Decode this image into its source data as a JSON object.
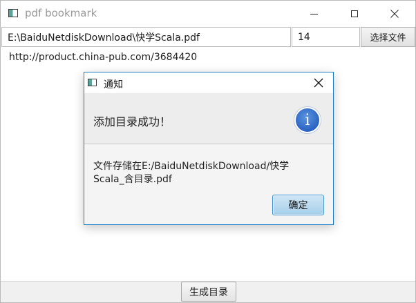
{
  "window": {
    "title": "pdf bookmark",
    "icon": "app-window-icon",
    "controls": {
      "minimize": "minimize-icon",
      "maximize": "maximize-icon",
      "close": "close-icon"
    }
  },
  "toolbar": {
    "file_path_value": "E:\\BaiduNetdiskDownload\\快学Scala.pdf",
    "page_offset_value": "14",
    "choose_file_label": "选择文件"
  },
  "main": {
    "url_text": "http://product.china-pub.com/3684420"
  },
  "footer": {
    "generate_label": "生成目录"
  },
  "dialog": {
    "title": "通知",
    "header_text": "添加目录成功！",
    "header_icon": "info-icon",
    "info_glyph": "i",
    "content_text": "文件存储在E:/BaiduNetdiskDownload/快学Scala_含目录.pdf",
    "ok_label": "确定",
    "accent_color": "#1c7ec4"
  }
}
